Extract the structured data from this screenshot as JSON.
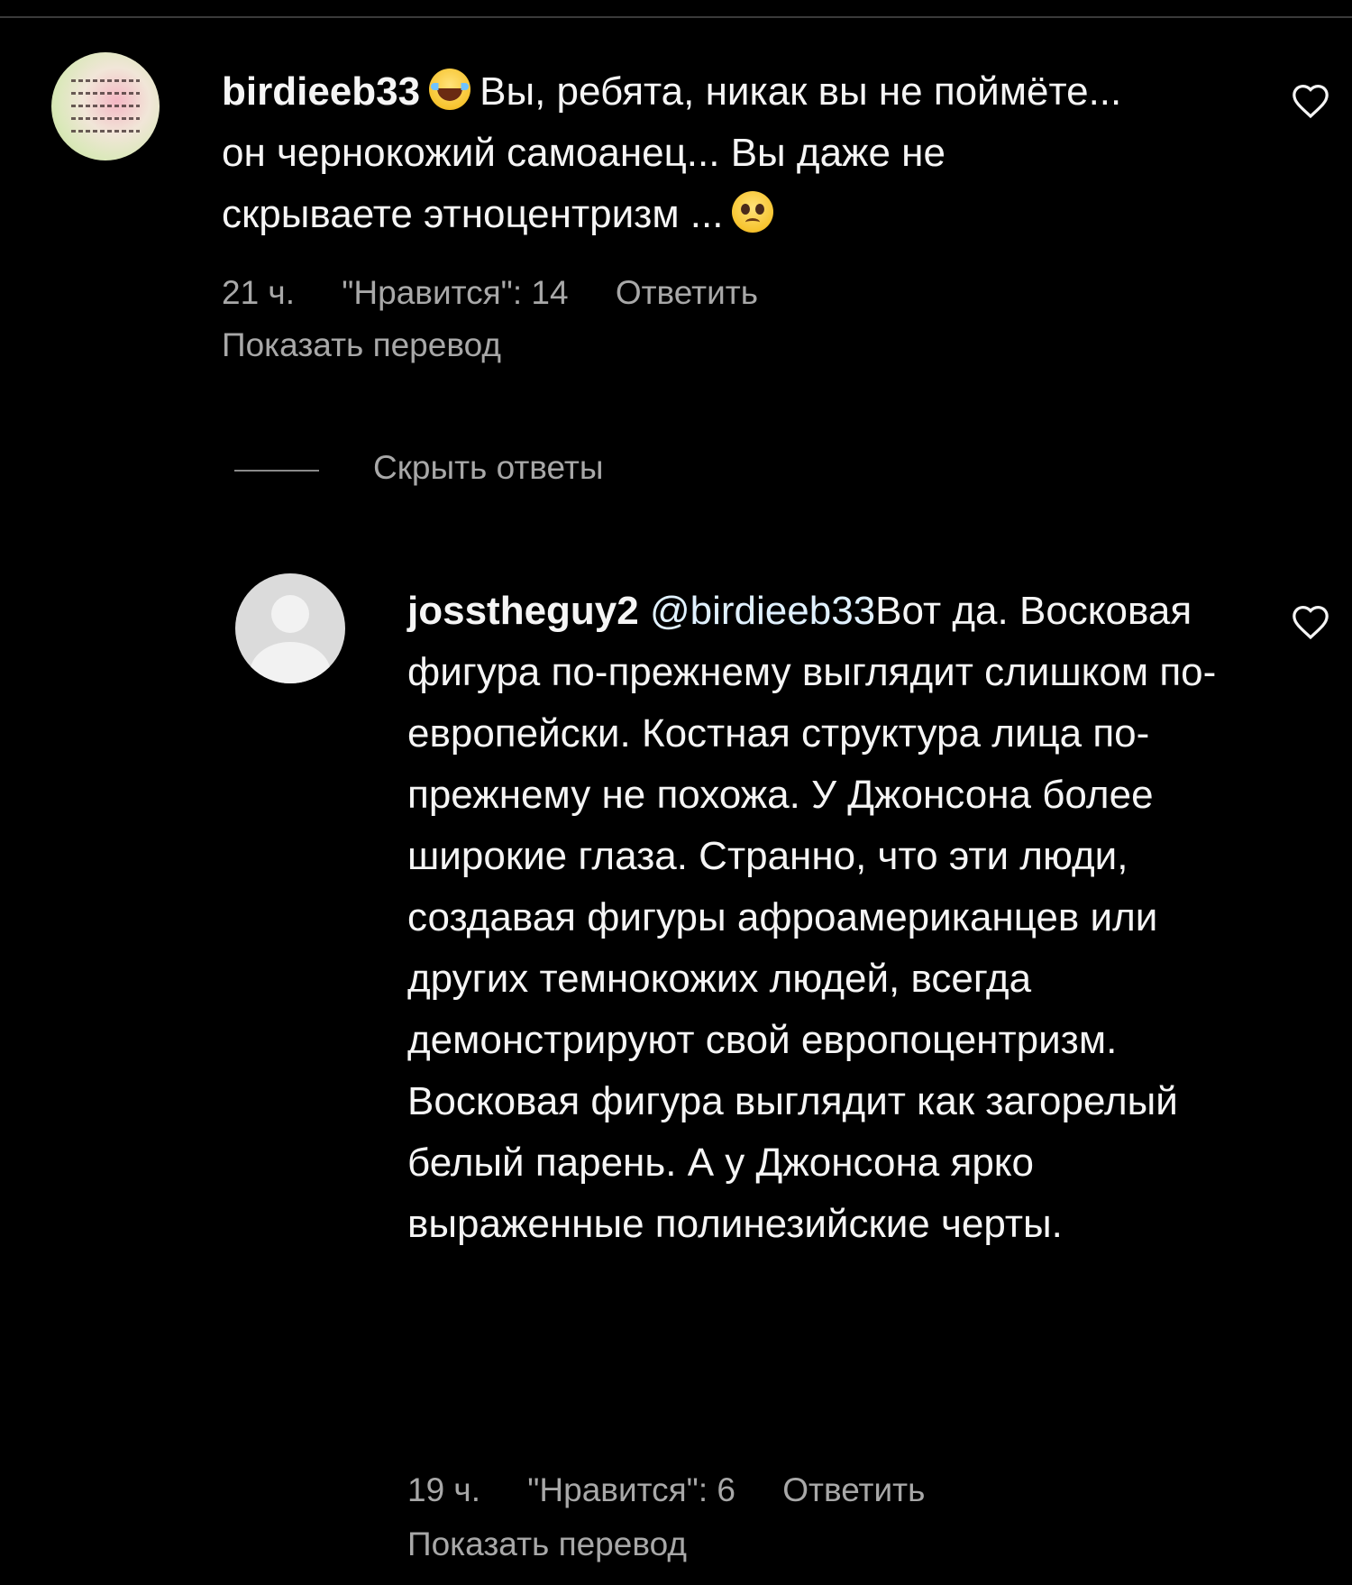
{
  "comments": [
    {
      "username": "birdieeb33",
      "text_1": "Вы, ребята, никак вы не поймёте... он чернокожий самоанец... Вы даже не скрываете этноцентризм ...",
      "time": "21 ч.",
      "likes": "\"Нравится\": 14",
      "reply": "Ответить",
      "translate": "Показать перевод"
    }
  ],
  "hide_replies": "Скрыть ответы",
  "reply": {
    "username": "josstheguy2",
    "mention": "@birdieeb33",
    "text": "Вот да. Восковая фигура по-прежнему выглядит слишком по-европейски. Костная структура лица по-прежнему не похожа. У Джонсона более широкие глаза. Странно, что эти люди, создавая фигуры афроамериканцев или других темнокожих людей, всегда демонстрируют свой европоцентризм. Восковая фигура выглядит как загорелый белый парень. А у Джонсона ярко выраженные полинезийские черты.",
    "time": "19 ч.",
    "likes": "\"Нравится\": 6",
    "reply": "Ответить",
    "translate": "Показать перевод"
  },
  "icons": {
    "like": "heart-outline-icon",
    "emoji_1": "face-with-tears-of-joy",
    "emoji_2": "pleading-face"
  }
}
